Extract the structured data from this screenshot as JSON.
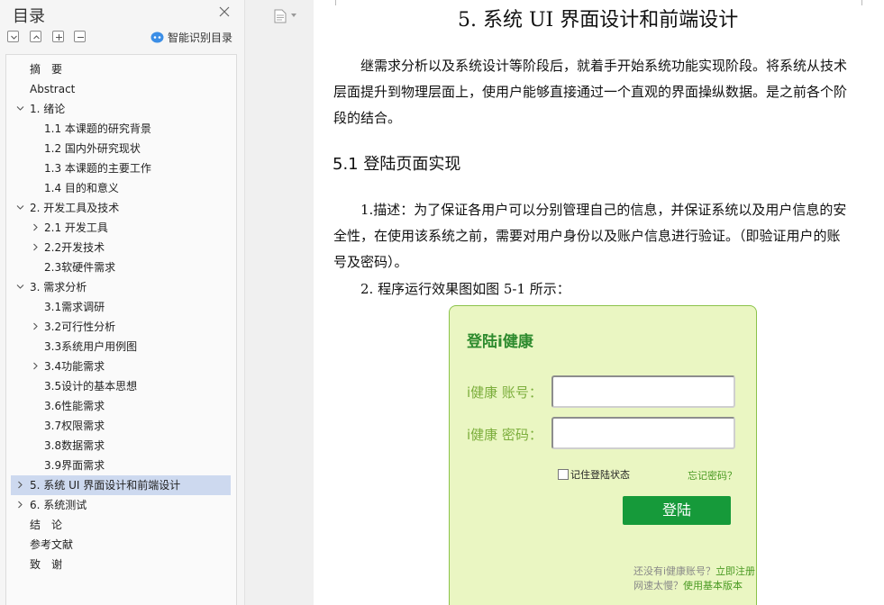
{
  "sidebar": {
    "title": "目录",
    "smart_toc_label": "智能识别目录",
    "toolbar": [
      "collapse-all",
      "expand-up",
      "add-heading",
      "remove-heading"
    ],
    "items": [
      {
        "label": "摘　要",
        "level": 1,
        "expandable": false,
        "expanded": false
      },
      {
        "label": "Abstract",
        "level": 1,
        "expandable": false,
        "expanded": false
      },
      {
        "label": "1.  绪论",
        "level": 1,
        "expandable": true,
        "expanded": true
      },
      {
        "label": "1.1  本课题的研究背景",
        "level": 2,
        "expandable": false,
        "expanded": false
      },
      {
        "label": "1.2  国内外研究现状",
        "level": 2,
        "expandable": false,
        "expanded": false
      },
      {
        "label": "1.3  本课题的主要工作",
        "level": 2,
        "expandable": false,
        "expanded": false
      },
      {
        "label": "1.4  目的和意义",
        "level": 2,
        "expandable": false,
        "expanded": false
      },
      {
        "label": "2.  开发工具及技术",
        "level": 1,
        "expandable": true,
        "expanded": true
      },
      {
        "label": "2.1  开发工具",
        "level": 2,
        "expandable": true,
        "expanded": false
      },
      {
        "label": "2.2开发技术",
        "level": 2,
        "expandable": true,
        "expanded": false
      },
      {
        "label": "2.3软硬件需求",
        "level": 2,
        "expandable": false,
        "expanded": false
      },
      {
        "label": "3.  需求分析",
        "level": 1,
        "expandable": true,
        "expanded": true
      },
      {
        "label": "3.1需求调研",
        "level": 2,
        "expandable": false,
        "expanded": false
      },
      {
        "label": "3.2可行性分析",
        "level": 2,
        "expandable": true,
        "expanded": false
      },
      {
        "label": "3.3系统用户用例图",
        "level": 2,
        "expandable": false,
        "expanded": false
      },
      {
        "label": "3.4功能需求",
        "level": 2,
        "expandable": true,
        "expanded": false
      },
      {
        "label": "3.5设计的基本思想",
        "level": 2,
        "expandable": false,
        "expanded": false
      },
      {
        "label": "3.6性能需求",
        "level": 2,
        "expandable": false,
        "expanded": false
      },
      {
        "label": "3.7权限需求",
        "level": 2,
        "expandable": false,
        "expanded": false
      },
      {
        "label": "3.8数据需求",
        "level": 2,
        "expandable": false,
        "expanded": false
      },
      {
        "label": "3.9界面需求",
        "level": 2,
        "expandable": false,
        "expanded": false
      },
      {
        "label": "5.  系统 UI 界面设计和前端设计",
        "level": 1,
        "expandable": true,
        "expanded": false,
        "active": true
      },
      {
        "label": "6.  系统测试",
        "level": 1,
        "expandable": true,
        "expanded": false
      },
      {
        "label": "结　论",
        "level": 1,
        "expandable": false,
        "expanded": false
      },
      {
        "label": "参考文献",
        "level": 1,
        "expandable": false,
        "expanded": false
      },
      {
        "label": "致　谢",
        "level": 1,
        "expandable": false,
        "expanded": false
      }
    ]
  },
  "document": {
    "heading1": "5.  系统 UI 界面设计和前端设计",
    "intro_lines": [
      "继需求分析以及系统设计等阶段后，就着手开始系统功能实现阶段。将系统从技术",
      "层面提升到物理层面上，使用户能够直接通过一个直观的界面操纵数据。是之前各个阶",
      "段的结合。"
    ],
    "heading2": "5.1  登陆页面实现",
    "desc_lines": [
      "1.描述：为了保证各用户可以分别管理自己的信息，并保证系统以及用户信息的安",
      "全性，在使用该系统之前，需要对用户身份以及账户信息进行验证。（即验证用户的账",
      "号及密码）。"
    ],
    "figure_caption_line": "2.  程序运行效果图如图 5-1 所示："
  },
  "login_figure": {
    "title": "登陆i健康",
    "account_label": "i健康 账号：",
    "password_label": "i健康 密码：",
    "remember_label": "记住登陆状态",
    "forgot_label": "忘记密码？",
    "login_button": "登陆",
    "no_account_prefix": "还没有i健康账号？",
    "register_link": "立即注册",
    "slow_net_prefix": "网速太慢？",
    "basic_version_link": "使用基本版本"
  },
  "colors": {
    "active_toc": "#cdd9ef",
    "login_bg": "#eaf6c2",
    "login_border": "#8bc34a",
    "login_title": "#2e8b2e",
    "login_button": "#169a3a",
    "link_green": "#4a9a23"
  }
}
